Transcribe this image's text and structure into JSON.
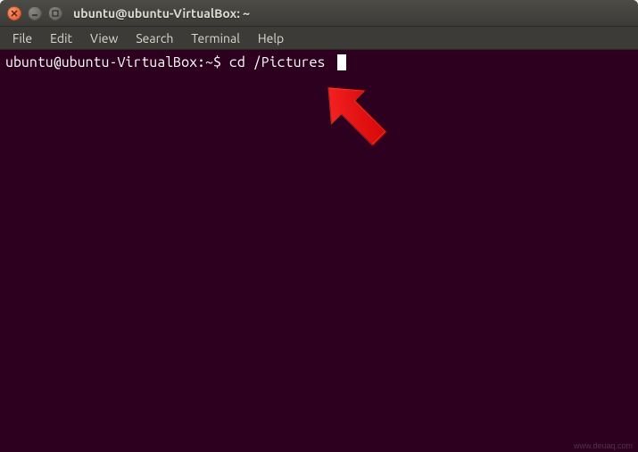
{
  "window": {
    "title": "ubuntu@ubuntu-VirtualBox: ~"
  },
  "menubar": {
    "items": [
      {
        "label": "File"
      },
      {
        "label": "Edit"
      },
      {
        "label": "View"
      },
      {
        "label": "Search"
      },
      {
        "label": "Terminal"
      },
      {
        "label": "Help"
      }
    ]
  },
  "terminal": {
    "prompt": "ubuntu@ubuntu-VirtualBox:~$ ",
    "command": "cd /Pictures"
  },
  "watermark": "www.deuaq.com"
}
